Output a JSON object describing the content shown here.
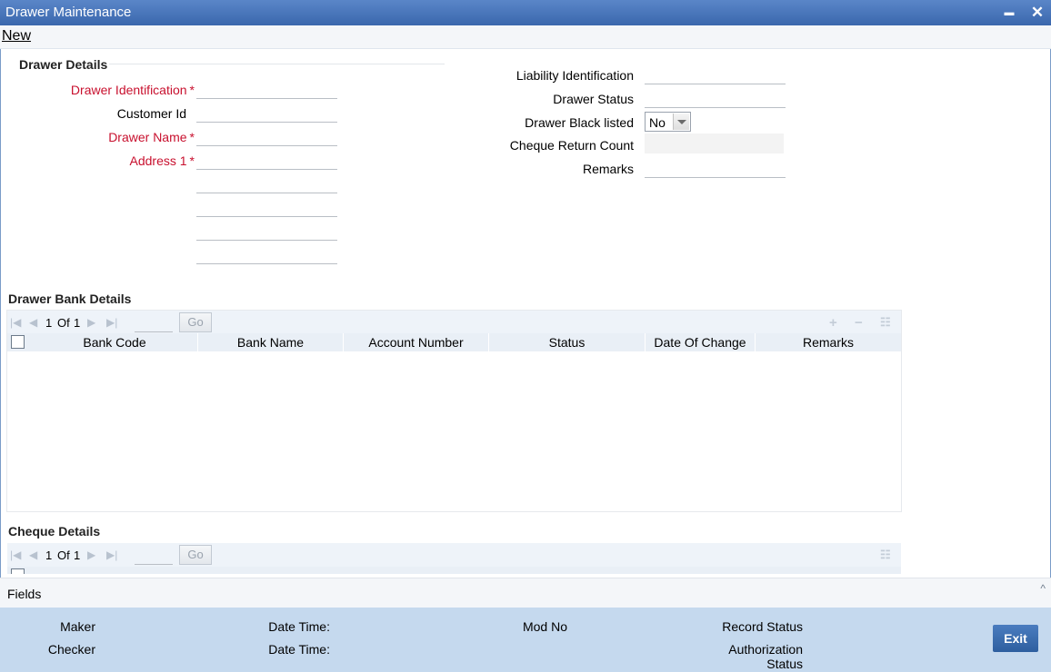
{
  "window": {
    "title": "Drawer Maintenance",
    "minimize_glyph": "▬",
    "close_glyph": "✕"
  },
  "toolbar": {
    "new_label": "New"
  },
  "drawer_details": {
    "section_title": "Drawer Details",
    "left_labels": {
      "drawer_identification": "Drawer Identification",
      "customer_id": "Customer Id",
      "drawer_name": "Drawer Name",
      "address_1": "Address 1"
    },
    "required_marker": "*",
    "right_labels": {
      "liability_identification": "Liability Identification",
      "drawer_status": "Drawer Status",
      "drawer_black_listed": "Drawer Black listed",
      "cheque_return_count": "Cheque Return Count",
      "remarks": "Remarks"
    },
    "black_listed_value": "No"
  },
  "drawer_bank_details": {
    "section_title": "Drawer Bank Details",
    "pager": {
      "current": "1",
      "of_label": "Of",
      "total": "1",
      "go_label": "Go"
    },
    "columns": [
      "Bank Code",
      "Bank Name",
      "Account Number",
      "Status",
      "Date Of Change",
      "Remarks"
    ]
  },
  "cheque_details": {
    "section_title": "Cheque Details",
    "pager": {
      "current": "1",
      "of_label": "Of",
      "total": "1",
      "go_label": "Go"
    }
  },
  "fields_bar": {
    "label": "Fields",
    "caret_glyph": "^"
  },
  "footer": {
    "maker": "Maker",
    "checker": "Checker",
    "date_time_1": "Date Time:",
    "date_time_2": "Date Time:",
    "mod_no": "Mod No",
    "record_status": "Record Status",
    "authorization_line1": "Authorization",
    "authorization_line2": "Status",
    "exit_label": "Exit"
  },
  "colors": {
    "title_bar": "#3a67ad",
    "required_label": "#c8102e",
    "footer_bg": "#c5d9ee",
    "exit_button": "#2e5f9f"
  },
  "icons": {
    "first": "first-page-icon",
    "prev": "previous-page-icon",
    "next": "next-page-icon",
    "last": "last-page-icon",
    "add": "add-row-icon",
    "delete": "delete-row-icon",
    "single_view": "single-view-icon"
  }
}
